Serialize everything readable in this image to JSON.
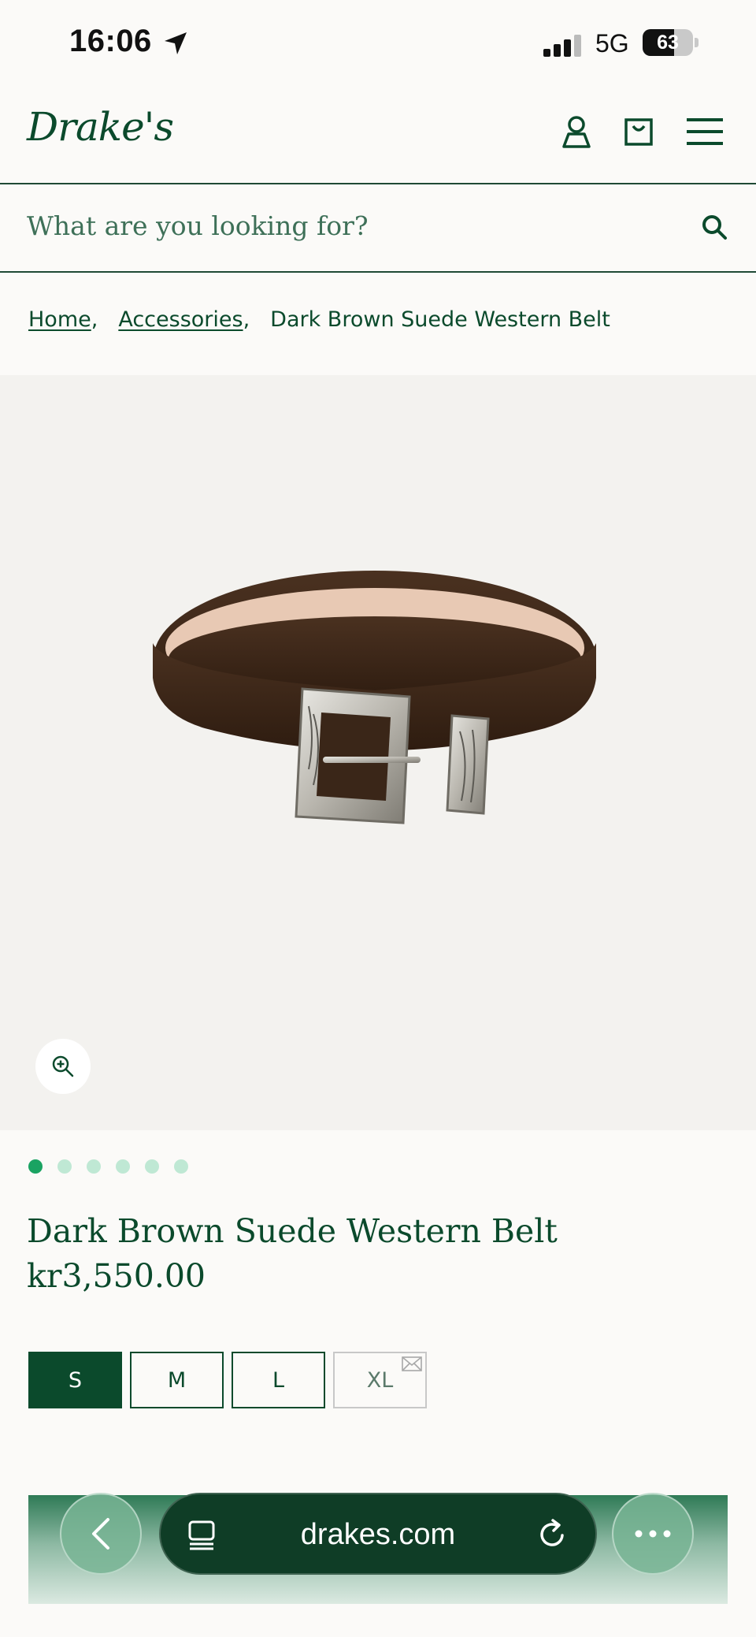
{
  "status_bar": {
    "time": "16:06",
    "network": "5G",
    "battery_percent": "63",
    "battery_level": 0.63
  },
  "header": {
    "logo": "Drake's",
    "icons": [
      "account-icon",
      "bag-icon",
      "menu-icon"
    ]
  },
  "search": {
    "placeholder": "What are you looking for?"
  },
  "breadcrumb": {
    "home": "Home",
    "accessories": "Accessories",
    "current": "Dark Brown Suede Western Belt"
  },
  "gallery": {
    "image_count": 6,
    "active_index": 0,
    "image_alt": "Dark Brown Suede Western Belt"
  },
  "product": {
    "title": "Dark Brown Suede Western Belt",
    "price": "kr3,550.00"
  },
  "sizes": [
    {
      "label": "S",
      "state": "selected"
    },
    {
      "label": "M",
      "state": "available"
    },
    {
      "label": "L",
      "state": "available"
    },
    {
      "label": "XL",
      "state": "sold-out-notify"
    }
  ],
  "browser": {
    "url": "drakes.com"
  },
  "colors": {
    "brand_green": "#0b4a2c",
    "dot_active": "#1aa362",
    "dot_inactive": "#bfe8d4"
  }
}
